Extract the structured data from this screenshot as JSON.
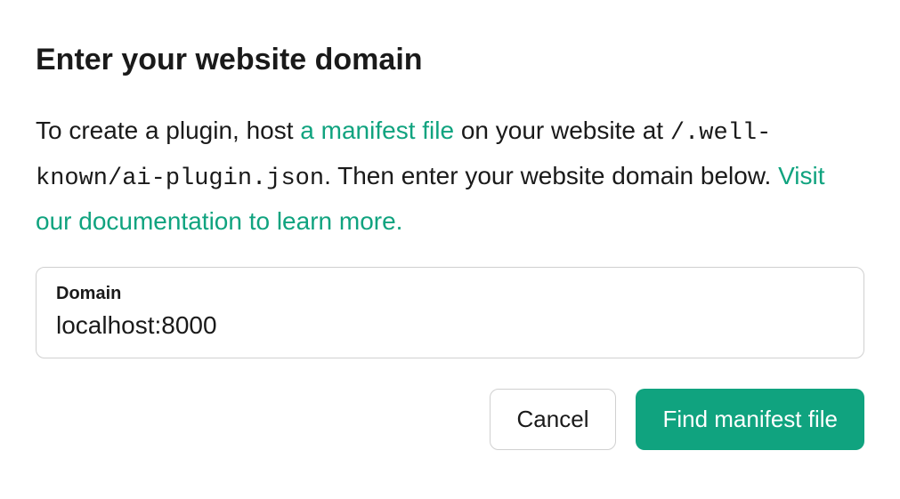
{
  "dialog": {
    "title": "Enter your website domain",
    "description_prefix": "To create a plugin, host ",
    "manifest_link": "a manifest file",
    "description_mid": " on your website at ",
    "manifest_path": "/.well-known/ai-plugin.json",
    "description_suffix": ". Then enter your website domain below. ",
    "doc_link": "Visit our documentation to learn more."
  },
  "input": {
    "label": "Domain",
    "value": "localhost:8000"
  },
  "buttons": {
    "cancel": "Cancel",
    "submit": "Find manifest file"
  },
  "colors": {
    "accent": "#10a37f"
  }
}
